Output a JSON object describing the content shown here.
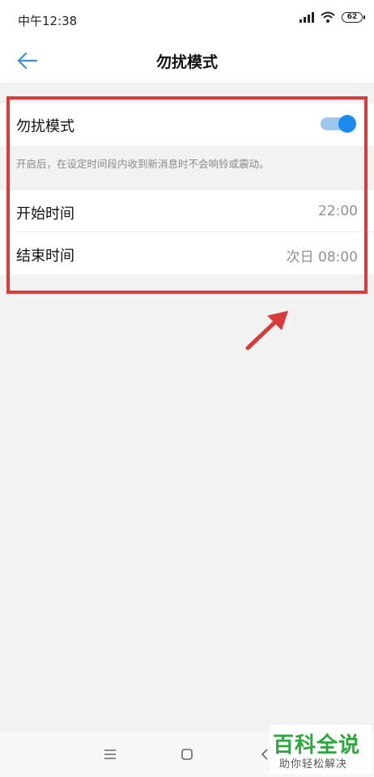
{
  "status_bar": {
    "time": "中午12:38",
    "battery_level": "62",
    "icons": [
      "signal-icon",
      "wifi-icon",
      "battery-icon"
    ]
  },
  "header": {
    "title": "勿扰模式",
    "back_icon": "arrow-left-icon"
  },
  "dnd": {
    "label": "勿扰模式",
    "enabled": true,
    "description": "开启后，在设定时间段内收到新消息时不会响铃或震动。"
  },
  "schedule": {
    "start_label": "开始时间",
    "start_value": "22:00",
    "end_label": "结束时间",
    "end_value": "次日 08:00"
  },
  "navigation": {
    "icons": [
      "menu-icon",
      "home-icon",
      "back-icon"
    ]
  },
  "watermark": {
    "main": "百科全说",
    "sub": "助你轻松解决"
  },
  "colors": {
    "accent": "#1c8aee",
    "highlight": "#d93b3b",
    "watermark": "#2aa83b"
  }
}
